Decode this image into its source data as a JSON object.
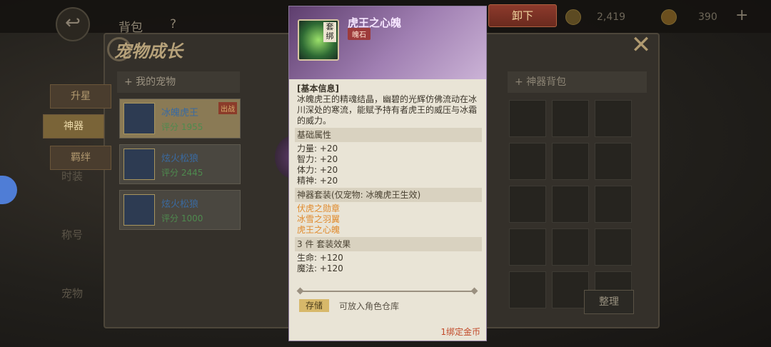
{
  "top": {
    "bag_title": "背包",
    "help": "?",
    "gold": "2,419",
    "diamond": "390",
    "plus": "+"
  },
  "window": {
    "title": "宠物成长"
  },
  "tabs": [
    "升星",
    "神器",
    "羁绊"
  ],
  "side_nodes": [
    "时装",
    "称号",
    "宠物"
  ],
  "pet_panel": {
    "header": "+ 我的宠物",
    "pets": [
      {
        "name": "冰魄虎王",
        "score": "评分 1955",
        "badge": "出战"
      },
      {
        "name": "炫火松狼",
        "score": "评分 2445"
      },
      {
        "name": "炫火松狼",
        "score": "评分 1000"
      }
    ]
  },
  "artifact_panel": {
    "header": "+ 神器背包",
    "sort_label": "整理"
  },
  "unequip_label": "卸下",
  "tooltip": {
    "item_name": "虎王之心魄",
    "item_type": "魄石",
    "bind_tag": "套绑",
    "sections": {
      "basic": "[基本信息]",
      "description": "冰魄虎王的精魂结晶，幽碧的光辉仿佛流动在冰川深处的寒流，能赋予持有者虎王的威压与冰霜的威力。",
      "base_attr": "基础属性",
      "attrs": [
        "力量: +20",
        "智力: +20",
        "体力: +20",
        "精神: +20"
      ],
      "set_header": "神器套装(仅宠物: 冰魄虎王生效)",
      "set_items": [
        "伏虎之勋章",
        "冰雪之羽翼",
        "虎王之心魄"
      ],
      "set_effect": "3 件  套装效果",
      "set_bonus": [
        "生命: +120",
        "魔法: +120"
      ]
    },
    "store_tag": "存储",
    "store_desc": "可放入角色仓库",
    "price": "1绑定金币"
  },
  "colors": {
    "accent": "#e08a2c",
    "tooltip_head": "#a07fb2",
    "unequip": "#8d3a2c"
  }
}
